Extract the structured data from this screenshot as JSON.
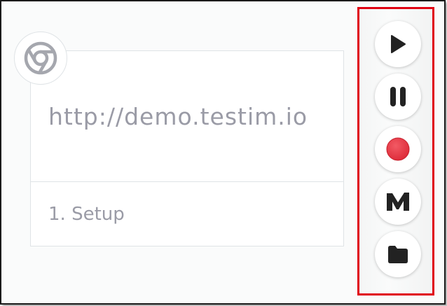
{
  "step_card": {
    "url": "http://demo.testim.io",
    "step_label": "1. Setup"
  },
  "browser_badge": {
    "icon": "chrome-icon"
  },
  "toolbar": {
    "buttons": [
      {
        "icon": "play-icon"
      },
      {
        "icon": "pause-icon"
      },
      {
        "icon": "record-icon"
      },
      {
        "icon": "testim-logo-icon"
      },
      {
        "icon": "folder-icon"
      }
    ]
  },
  "colors": {
    "record": "#e8323f",
    "icon_dark": "#222222",
    "highlight_border": "#e00012",
    "muted_text": "#9a9ba6"
  }
}
